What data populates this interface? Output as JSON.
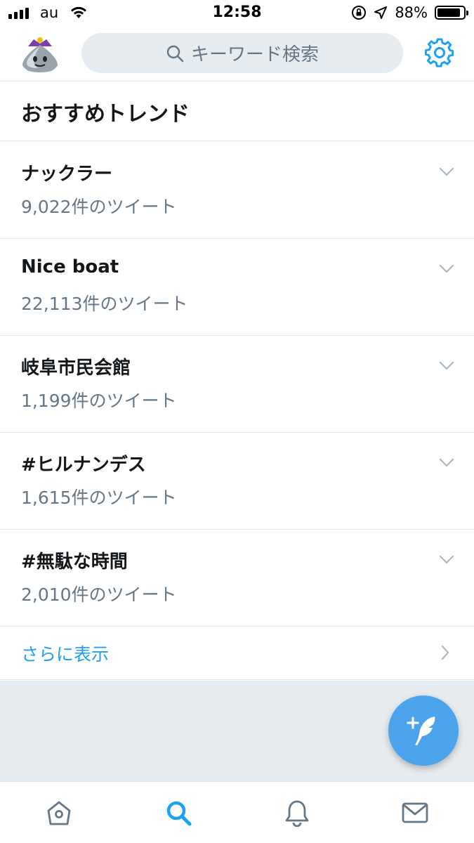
{
  "status_bar": {
    "carrier": "au",
    "time": "12:58",
    "battery_percent": "88%",
    "battery_level": 0.88,
    "icons": [
      "signal-icon",
      "wifi-icon",
      "orientation-lock-icon",
      "location-icon",
      "battery-icon"
    ]
  },
  "header": {
    "avatar_icon": "metal-slime-avatar",
    "search_placeholder": "キーワード検索",
    "settings_icon": "gear-icon",
    "accent_color": "#1da1f2"
  },
  "section": {
    "title": "おすすめトレンド"
  },
  "trends": [
    {
      "name": "ナックラー",
      "count": "9,022件のツイート"
    },
    {
      "name": "Nice boat",
      "count": "22,113件のツイート"
    },
    {
      "name": "岐阜市民会館",
      "count": "1,199件のツイート"
    },
    {
      "name": "#ヒルナンデス",
      "count": "1,615件のツイート"
    },
    {
      "name": "#無駄な時間",
      "count": "2,010件のツイート"
    }
  ],
  "show_more": {
    "label": "さらに表示"
  },
  "fab": {
    "icon": "compose-tweet-icon"
  },
  "tab_bar": {
    "tabs": [
      {
        "icon": "home-icon",
        "active": false
      },
      {
        "icon": "search-icon",
        "active": true
      },
      {
        "icon": "notifications-icon",
        "active": false
      },
      {
        "icon": "messages-icon",
        "active": false
      }
    ]
  }
}
